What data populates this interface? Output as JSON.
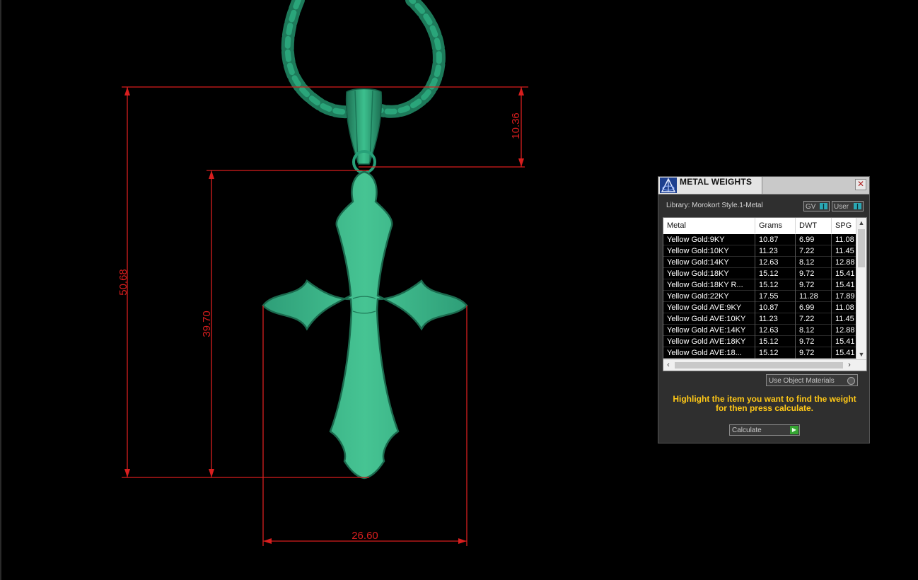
{
  "dimensions": {
    "total_height": "50.68",
    "cross_height": "39.70",
    "bail_height": "10.36",
    "cross_width": "26.60"
  },
  "panel": {
    "title": "METAL WEIGHTS",
    "close_label": "✕",
    "library": "Library: Morokort Style.1-Metal",
    "toggle_gv": "GV",
    "toggle_user": "User",
    "columns": [
      "Metal",
      "Grams",
      "DWT",
      "SPG"
    ],
    "rows": [
      [
        "Yellow Gold:9KY",
        "10.87",
        "6.99",
        "11.08"
      ],
      [
        "Yellow Gold:10KY",
        "11.23",
        "7.22",
        "11.45"
      ],
      [
        "Yellow Gold:14KY",
        "12.63",
        "8.12",
        "12.88"
      ],
      [
        "Yellow Gold:18KY",
        "15.12",
        "9.72",
        "15.41"
      ],
      [
        "Yellow Gold:18KY R...",
        "15.12",
        "9.72",
        "15.41"
      ],
      [
        "Yellow Gold:22KY",
        "17.55",
        "11.28",
        "17.89"
      ],
      [
        "Yellow Gold AVE:9KY",
        "10.87",
        "6.99",
        "11.08"
      ],
      [
        "Yellow Gold AVE:10KY",
        "11.23",
        "7.22",
        "11.45"
      ],
      [
        "Yellow Gold AVE:14KY",
        "12.63",
        "8.12",
        "12.88"
      ],
      [
        "Yellow Gold AVE:18KY",
        "15.12",
        "9.72",
        "15.41"
      ],
      [
        "Yellow Gold AVE:18...",
        "15.12",
        "9.72",
        "15.41"
      ]
    ],
    "use_object_label": "Use Object Materials",
    "hint": "Highlight the item you want to find the weight for then press calculate.",
    "calculate_label": "Calculate"
  },
  "colors": {
    "dimension": "#d81e1e",
    "metal_green": "#3db88a",
    "hint_yellow": "#ffc817"
  }
}
